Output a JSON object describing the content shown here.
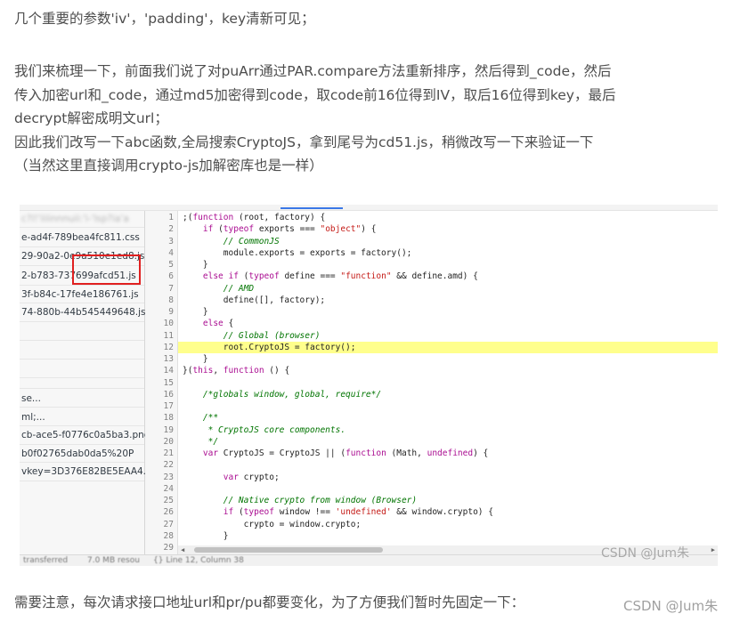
{
  "article": {
    "paragraph_top": "几个重要的参数'iv'，'padding'，key清新可见；",
    "body_lines": [
      "我们来梳理一下，前面我们说了对puArr通过PAR.compare方法重新排序，然后得到_code，然后",
      "传入加密url和_code，通过md5加密得到code，取code前16位得到IV，取后16位得到key，最后",
      "decrypt解密成明文url；",
      "因此我们改写一下abc函数,全局搜索CryptoJS，拿到尾号为cd51.js，稍微改写一下来验证一下",
      "（当然这里直接调用crypto-js加解密库也是一样）"
    ],
    "paragraph_bottom": "需要注意，每次请求接口地址url和pr/pu都要变化，为了方便我们暂时先固定一下："
  },
  "screenshot": {
    "file_list": [
      {
        "text": "c?l!'iiiinnnuii:'i-'lsp?ia'a",
        "blurred": true
      },
      {
        "text": "e-ad4f-789bea4fc811.css",
        "blurred": false
      },
      {
        "text": "29-90a2-0e9a510e1ed8.js",
        "blurred": false
      },
      {
        "text": "2-b783-737699afcd51.js",
        "blurred": false
      },
      {
        "text": "3f-b84c-17fe4e186761.js",
        "blurred": false
      },
      {
        "text": "74-880b-44b545449648.js",
        "blurred": false
      },
      {
        "text": "se...",
        "blurred": false
      },
      {
        "text": "ml;...",
        "blurred": false
      },
      {
        "text": "cb-ace5-f0776c0a5ba3.png",
        "blurred": false
      },
      {
        "text": "b0f02765dab0da5%20P",
        "blurred": false
      },
      {
        "text": "vkey=3D376E82BE5EAA4...",
        "blurred": false
      }
    ],
    "code_lines": [
      {
        "n": "1",
        "html": ";(<span class=\"kw\">function</span> (root, factory) {"
      },
      {
        "n": "2",
        "html": "    <span class=\"kw\">if</span> (<span class=\"kw\">typeof</span> exports === <span class=\"str\">\"object\"</span>) {"
      },
      {
        "n": "3",
        "html": "        <span class=\"cmt\">// CommonJS</span>"
      },
      {
        "n": "4",
        "html": "        module.exports = exports = factory();"
      },
      {
        "n": "5",
        "html": "    }"
      },
      {
        "n": "6",
        "html": "    <span class=\"kw\">else if</span> (<span class=\"kw\">typeof</span> define === <span class=\"str\">\"function\"</span> &amp;&amp; define.amd) {"
      },
      {
        "n": "7",
        "html": "        <span class=\"cmt\">// AMD</span>"
      },
      {
        "n": "8",
        "html": "        define([], factory);"
      },
      {
        "n": "9",
        "html": "    }"
      },
      {
        "n": "10",
        "html": "    <span class=\"kw\">else</span> {"
      },
      {
        "n": "11",
        "html": "        <span class=\"cmt\">// Global (browser)</span>"
      },
      {
        "n": "12",
        "html": "        root.CryptoJS = factory();",
        "highlight": true
      },
      {
        "n": "13",
        "html": "    }"
      },
      {
        "n": "14",
        "html": "}(<span class=\"kw\">this</span>, <span class=\"kw\">function</span> () {"
      },
      {
        "n": "15",
        "html": ""
      },
      {
        "n": "16",
        "html": "    <span class=\"cmt\">/*globals window, global, require*/</span>"
      },
      {
        "n": "17",
        "html": ""
      },
      {
        "n": "18",
        "html": "    <span class=\"cmt\">/**</span>"
      },
      {
        "n": "19",
        "html": "    <span class=\"cmt\"> * CryptoJS core components.</span>"
      },
      {
        "n": "20",
        "html": "    <span class=\"cmt\"> */</span>"
      },
      {
        "n": "21",
        "html": "    <span class=\"kw\">var</span> CryptoJS = CryptoJS || (<span class=\"kw\">function</span> (Math, <span class=\"kw\">undefined</span>) {"
      },
      {
        "n": "22",
        "html": ""
      },
      {
        "n": "23",
        "html": "        <span class=\"kw\">var</span> crypto;"
      },
      {
        "n": "24",
        "html": ""
      },
      {
        "n": "25",
        "html": "        <span class=\"cmt\">// Native crypto from window (Browser)</span>"
      },
      {
        "n": "26",
        "html": "        <span class=\"kw\">if</span> (<span class=\"kw\">typeof</span> window !== <span class=\"str\">'undefined'</span> &amp;&amp; window.crypto) {"
      },
      {
        "n": "27",
        "html": "            crypto = window.crypto;"
      },
      {
        "n": "28",
        "html": "        }"
      },
      {
        "n": "29",
        "html": ""
      }
    ],
    "status_left": "transferred",
    "status_mid": "7.0 MB resou",
    "status_right": "{}  Line 12, Column 38"
  },
  "watermarks": {
    "inner": "CSDN @Jum朱",
    "outer": "CSDN @Jum朱"
  },
  "colors": {
    "highlight": "#ffff8c",
    "red_box": "#e02020",
    "keyword": "#aa0d91",
    "string": "#c41a16",
    "comment": "#007400"
  }
}
